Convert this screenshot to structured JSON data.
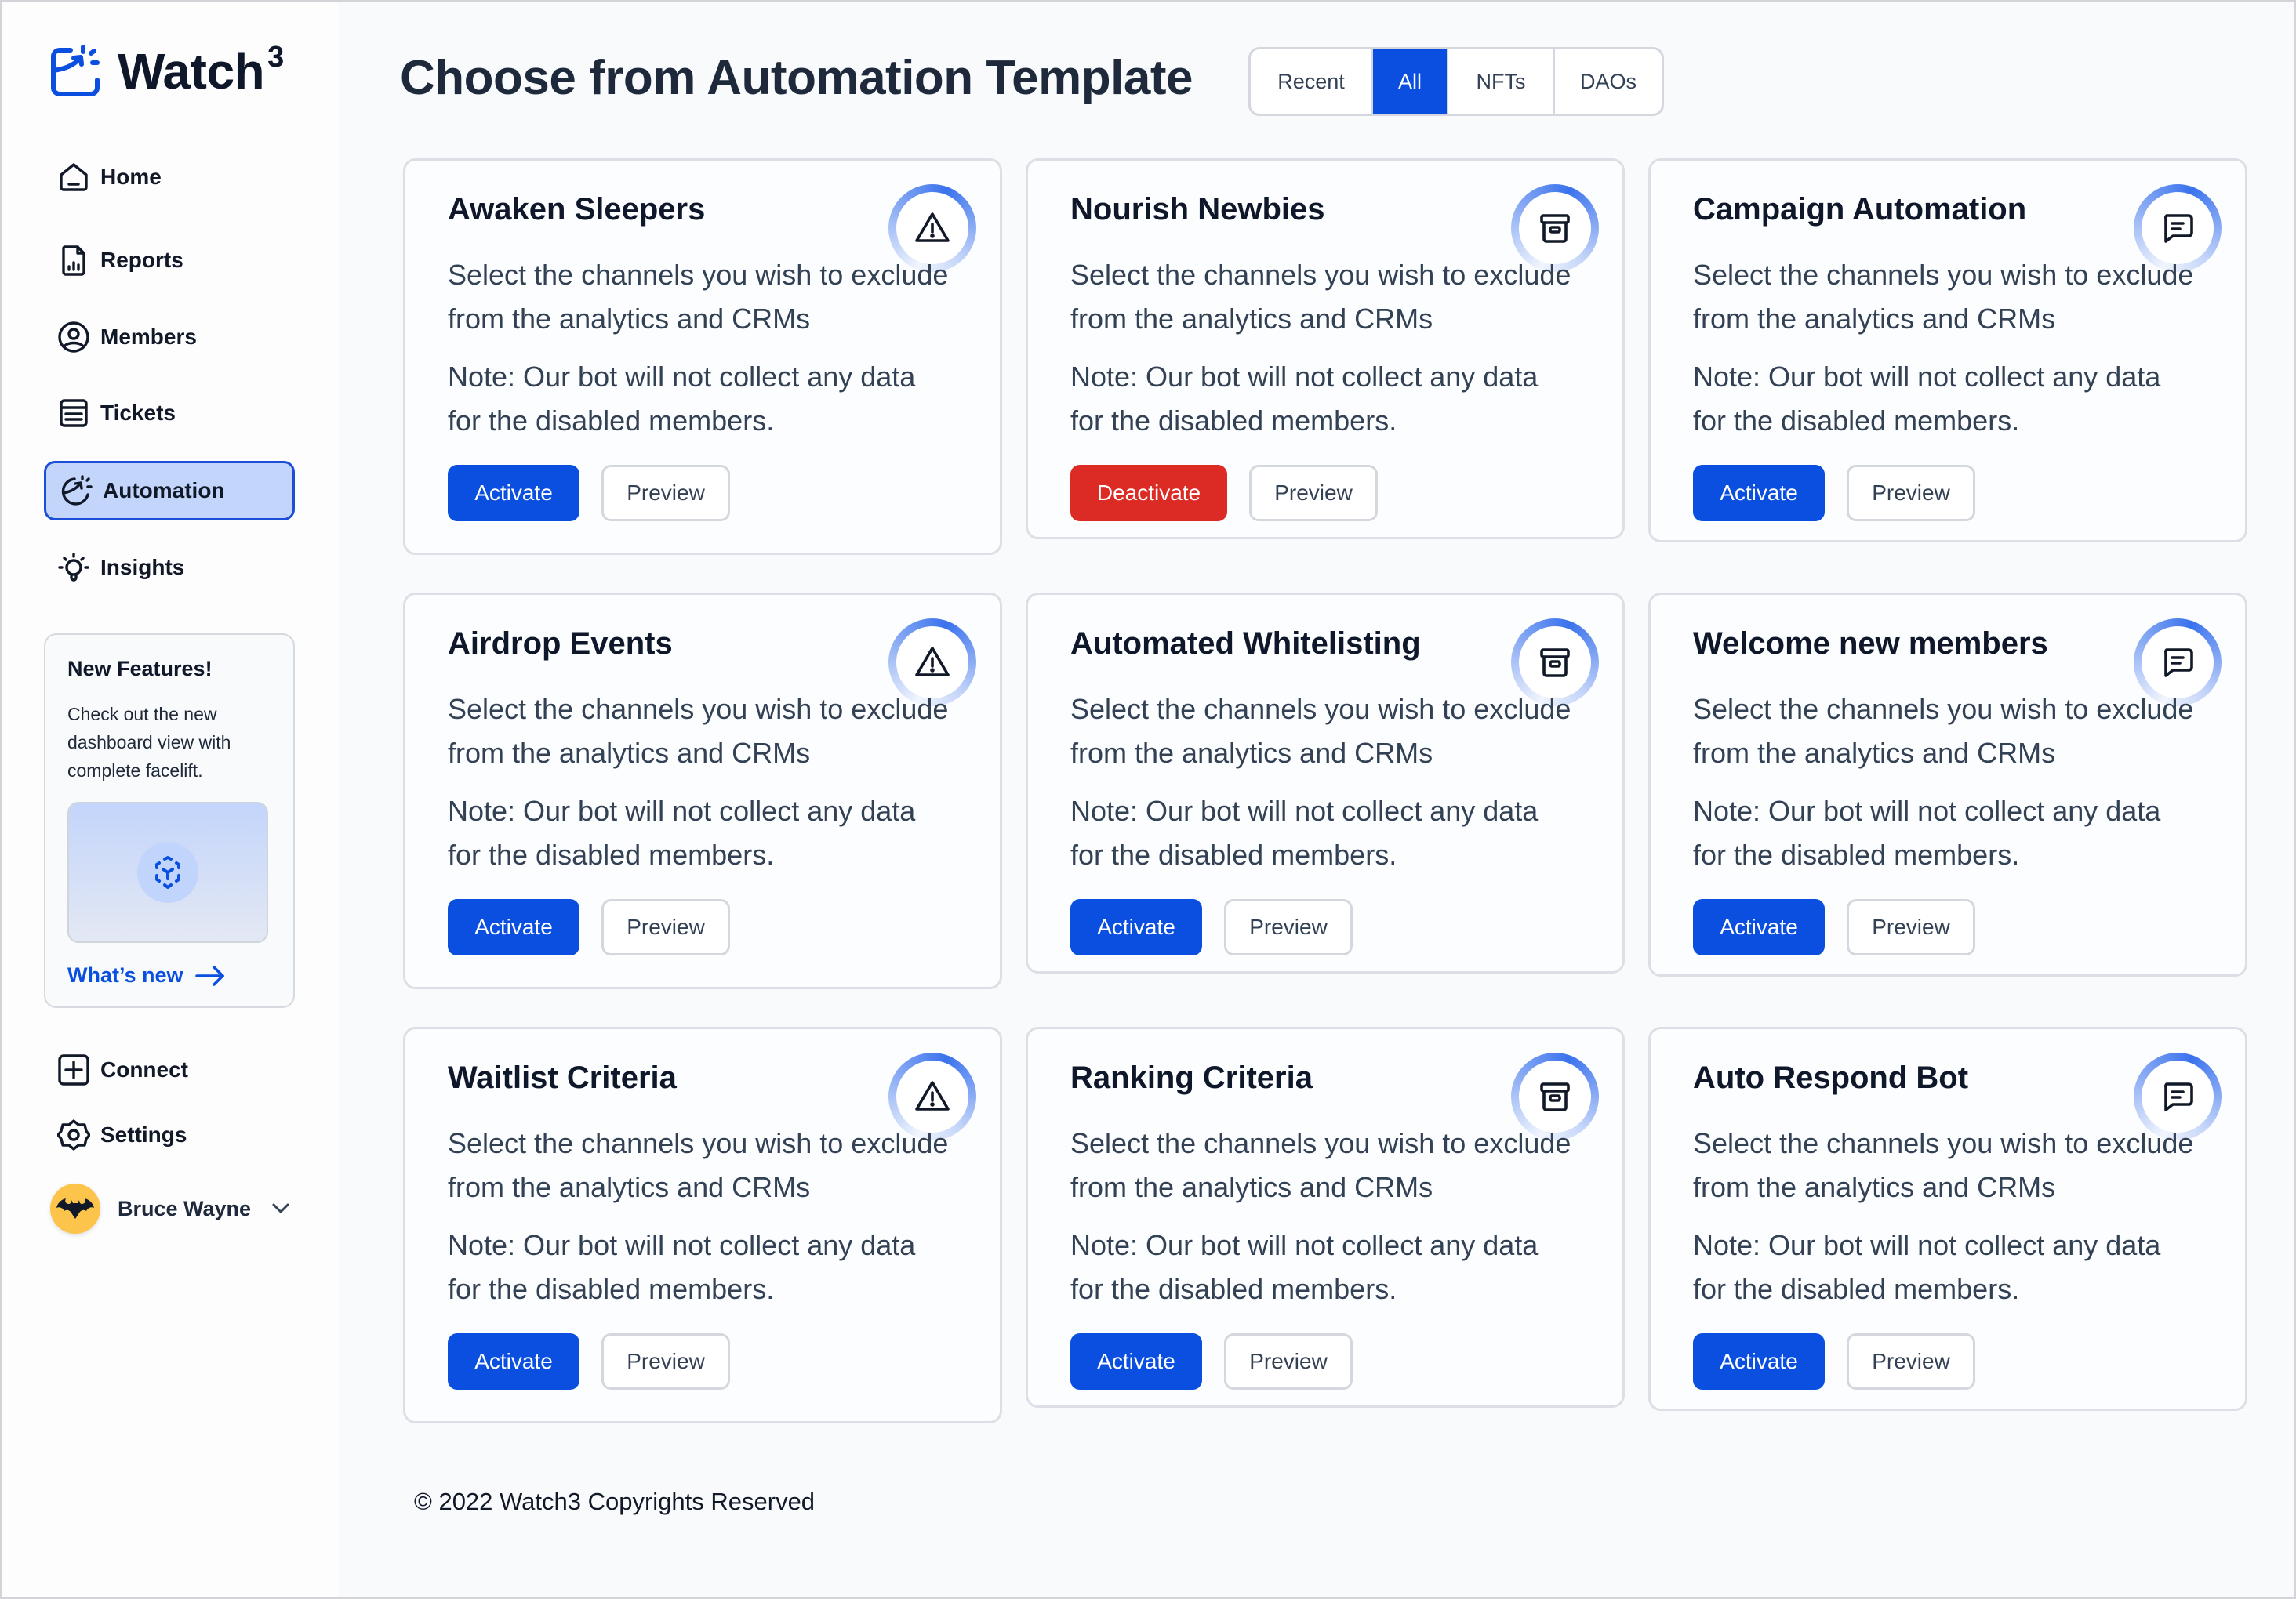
{
  "app": {
    "name": "Watch",
    "name_sup": "3"
  },
  "sidebar": {
    "items": [
      {
        "label": "Home",
        "icon": "home-icon"
      },
      {
        "label": "Reports",
        "icon": "report-icon"
      },
      {
        "label": "Members",
        "icon": "user-circle-icon"
      },
      {
        "label": "Tickets",
        "icon": "ticket-icon"
      },
      {
        "label": "Automation",
        "icon": "automation-icon",
        "active": true
      },
      {
        "label": "Insights",
        "icon": "lightbulb-icon"
      }
    ],
    "feature_card": {
      "title": "New Features!",
      "description": "Check out the new dashboard view with complete facelift.",
      "link_label": "What’s new"
    },
    "bottom_items": [
      {
        "label": "Connect",
        "icon": "plus-square-icon"
      },
      {
        "label": "Settings",
        "icon": "gear-icon"
      }
    ],
    "user": {
      "name": "Bruce Wayne"
    }
  },
  "header": {
    "title": "Choose from Automation Template",
    "tabs": [
      {
        "label": "Recent",
        "active": false
      },
      {
        "label": "All",
        "active": true
      },
      {
        "label": "NFTs",
        "active": false
      },
      {
        "label": "DAOs",
        "active": false
      }
    ]
  },
  "cards": [
    {
      "title": "Awaken Sleepers",
      "icon": "warning-icon",
      "description": "Select the channels you wish to exclude from the analytics and CRMs",
      "note": "Note: Our bot will not collect any data for the disabled members.",
      "primary_label": "Activate",
      "primary_variant": "primary",
      "secondary_label": "Preview"
    },
    {
      "title": "Nourish Newbies",
      "icon": "archive-icon",
      "description": "Select the channels you wish to exclude from the analytics and CRMs",
      "note": "Note: Our bot will not collect any data for the disabled members.",
      "primary_label": "Deactivate",
      "primary_variant": "danger",
      "secondary_label": "Preview"
    },
    {
      "title": "Campaign Automation",
      "icon": "message-icon",
      "description": "Select the channels you wish to exclude from the analytics and CRMs",
      "note": "Note: Our bot will not collect any data for the disabled members.",
      "primary_label": "Activate",
      "primary_variant": "primary",
      "secondary_label": "Preview"
    },
    {
      "title": "Airdrop Events",
      "icon": "warning-icon",
      "description": "Select the channels you wish to exclude from the analytics and CRMs",
      "note": "Note: Our bot will not collect any data for the disabled members.",
      "primary_label": "Activate",
      "primary_variant": "primary",
      "secondary_label": "Preview"
    },
    {
      "title": "Automated Whitelisting",
      "icon": "archive-icon",
      "description": "Select the channels you wish to exclude from the analytics and CRMs",
      "note": "Note: Our bot will not collect any data for the disabled members.",
      "primary_label": "Activate",
      "primary_variant": "primary",
      "secondary_label": "Preview"
    },
    {
      "title": "Welcome new members",
      "icon": "message-icon",
      "description": "Select the channels you wish to exclude from the analytics and CRMs",
      "note": "Note: Our bot will not collect any data for the disabled members.",
      "primary_label": "Activate",
      "primary_variant": "primary",
      "secondary_label": "Preview"
    },
    {
      "title": "Waitlist Criteria",
      "icon": "warning-icon",
      "description": "Select the channels you wish to exclude from the analytics and CRMs",
      "note": "Note: Our bot will not collect any data for the disabled members.",
      "primary_label": "Activate",
      "primary_variant": "primary",
      "secondary_label": "Preview"
    },
    {
      "title": "Ranking Criteria",
      "icon": "archive-icon",
      "description": "Select the channels you wish to exclude from the analytics and CRMs",
      "note": "Note: Our bot will not collect any data for the disabled members.",
      "primary_label": "Activate",
      "primary_variant": "primary",
      "secondary_label": "Preview"
    },
    {
      "title": "Auto Respond Bot",
      "icon": "message-icon",
      "description": "Select the channels you wish to exclude from the analytics and CRMs",
      "note": "Note: Our bot will not collect any data for the disabled members.",
      "primary_label": "Activate",
      "primary_variant": "primary",
      "secondary_label": "Preview"
    }
  ],
  "footer": {
    "text": "© 2022 Watch3 Copyrights Reserved"
  },
  "colors": {
    "accent": "#0a4fe0",
    "danger": "#dc2a24",
    "active_nav_bg": "#c3d5fb",
    "avatar_bg": "#fcc44a"
  }
}
